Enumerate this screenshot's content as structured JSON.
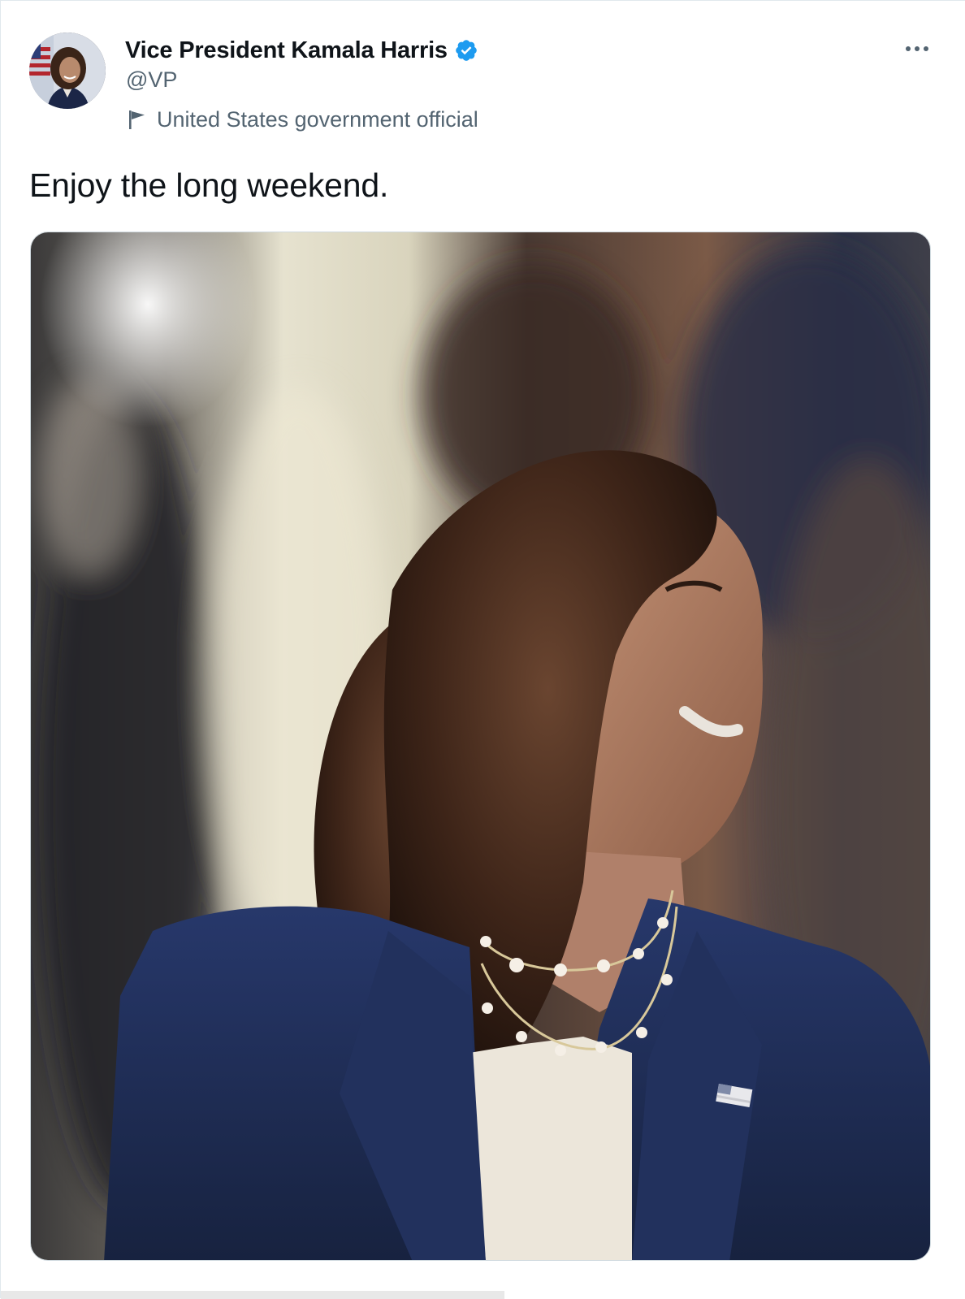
{
  "tweet": {
    "author": {
      "display_name": "Vice President Kamala Harris",
      "handle": "@VP",
      "verified": true,
      "label": "United States government official"
    },
    "text": "Enjoy the long weekend.",
    "media": {
      "type": "photo"
    }
  },
  "icons": {
    "verified": "verified-badge-icon",
    "label": "flag-icon",
    "more": "more-options-icon"
  },
  "colors": {
    "verified_blue": "#1d9bf0",
    "secondary_text": "#536471",
    "primary_text": "#0f1419"
  }
}
